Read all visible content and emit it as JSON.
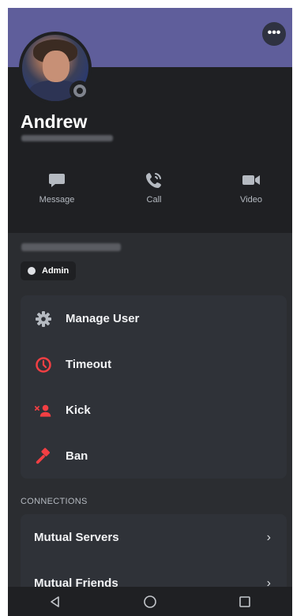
{
  "header": {
    "more_icon": "more-dots-icon",
    "user_name": "Andrew",
    "status": "offline",
    "colors": {
      "banner": "#5f5e9b",
      "header_bg": "#1f2023",
      "panel_bg": "#2b2d31"
    }
  },
  "actions": [
    {
      "label": "Message",
      "icon": "message-bubble-icon"
    },
    {
      "label": "Call",
      "icon": "phone-call-icon"
    },
    {
      "label": "Video",
      "icon": "video-camera-icon"
    }
  ],
  "roles": {
    "items": [
      {
        "label": "Admin",
        "color": "#dfe1e5"
      }
    ]
  },
  "moderation": {
    "items": [
      {
        "label": "Manage User",
        "icon": "gear-icon",
        "color": "#b5bac1"
      },
      {
        "label": "Timeout",
        "icon": "clock-icon",
        "color": "#f23f43"
      },
      {
        "label": "Kick",
        "icon": "kick-user-icon",
        "color": "#f23f43"
      },
      {
        "label": "Ban",
        "icon": "ban-hammer-icon",
        "color": "#f23f43"
      }
    ]
  },
  "connections": {
    "heading": "CONNECTIONS",
    "items": [
      {
        "label": "Mutual Servers"
      },
      {
        "label": "Mutual Friends"
      }
    ]
  },
  "navbar": {
    "items": [
      "back-triangle-icon",
      "home-circle-icon",
      "recents-square-icon"
    ]
  }
}
